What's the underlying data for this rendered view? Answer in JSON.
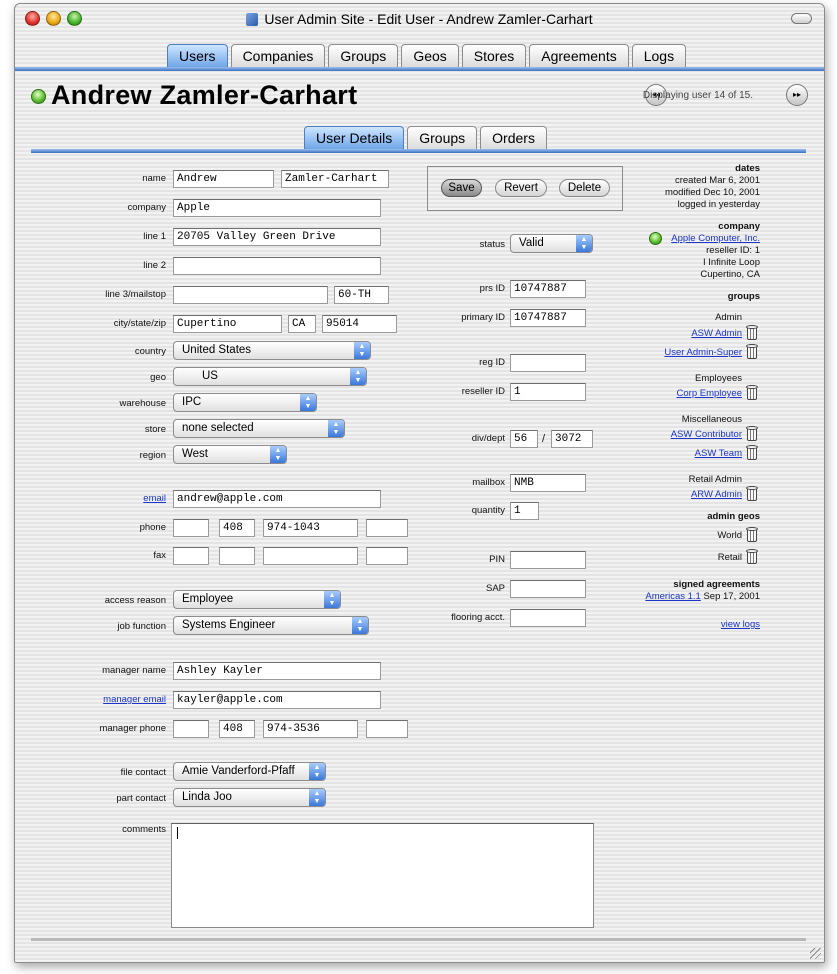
{
  "window": {
    "title": "User Admin Site - Edit User - Andrew Zamler-Carhart"
  },
  "main_tabs": [
    "Users",
    "Companies",
    "Groups",
    "Geos",
    "Stores",
    "Agreements",
    "Logs"
  ],
  "main_tab_active": "Users",
  "header": {
    "user_name": "Andrew Zamler-Carhart",
    "nav_text": "Displaying user 14 of 15."
  },
  "sub_tabs": [
    "User Details",
    "Groups",
    "Orders"
  ],
  "sub_tab_active": "User Details",
  "labels": {
    "name": "name",
    "company": "company",
    "line1": "line 1",
    "line2": "line 2",
    "line3": "line 3/mailstop",
    "city": "city/state/zip",
    "country": "country",
    "geo": "geo",
    "warehouse": "warehouse",
    "store": "store",
    "region": "region",
    "email": "email",
    "phone": "phone",
    "fax": "fax",
    "access_reason": "access reason",
    "job_function": "job function",
    "manager_name": "manager name",
    "manager_email": "manager email",
    "manager_phone": "manager phone",
    "file_contact": "file contact",
    "part_contact": "part contact",
    "comments": "comments",
    "status": "status",
    "prs_id": "prs ID",
    "primary_id": "primary ID",
    "reg_id": "reg ID",
    "reseller_id": "reseller ID",
    "div_dept": "div/dept",
    "mailbox": "mailbox",
    "quantity": "quantity",
    "pin": "PIN",
    "sap": "SAP",
    "flooring": "flooring acct."
  },
  "fields": {
    "first_name": "Andrew",
    "last_name": "Zamler-Carhart",
    "company": "Apple",
    "line1": "20705 Valley Green Drive",
    "line2": "",
    "line3": "",
    "mailstop": "60-TH",
    "city": "Cupertino",
    "state": "CA",
    "zip": "95014",
    "country": "United States",
    "geo": "US",
    "warehouse": "IPC",
    "store": "none selected",
    "region": "West",
    "email": "andrew@apple.com",
    "phone": [
      "",
      "408",
      "974-1043",
      ""
    ],
    "fax": [
      "",
      "",
      "",
      ""
    ],
    "access_reason": "Employee",
    "job_function": "Systems Engineer",
    "manager_name": "Ashley Kayler",
    "manager_email": "kayler@apple.com",
    "manager_phone": [
      "",
      "408",
      "974-3536",
      ""
    ],
    "file_contact": "Amie Vanderford-Pfaff",
    "part_contact": "Linda Joo",
    "comments": "",
    "status": "Valid",
    "prs_id": "10747887",
    "primary_id": "10747887",
    "reg_id": "",
    "reseller_id": "1",
    "div": "56",
    "div_sep": "/",
    "dept": "3072",
    "mailbox": "NMB",
    "quantity": "1",
    "pin": "",
    "sap": "",
    "flooring": ""
  },
  "actions": {
    "save": "Save",
    "revert": "Revert",
    "delete": "Delete"
  },
  "sidebar": {
    "dates_title": "dates",
    "created": "created Mar 6, 2001",
    "modified": "modified Dec 10, 2001",
    "logged": "logged in yesterday",
    "company_title": "company",
    "company_name": "Apple Computer, Inc.",
    "reseller": "reseller ID: 1",
    "address1": "I Infinite Loop",
    "address2": "Cupertino, CA",
    "groups_title": "groups",
    "group_sections": [
      {
        "title": "Admin",
        "items": [
          "ASW Admin",
          "User Admin-Super"
        ]
      },
      {
        "title": "Employees",
        "items": [
          "Corp Employee"
        ]
      },
      {
        "title": "Miscellaneous",
        "items": [
          "ASW Contributor",
          "ASW Team"
        ]
      },
      {
        "title": "Retail Admin",
        "items": [
          "ARW Admin"
        ]
      }
    ],
    "admin_geos_title": "admin geos",
    "admin_geos": [
      "World",
      "Retail"
    ],
    "agreements_title": "signed agreements",
    "agreement_link": "Americas 1.1",
    "agreement_date": "Sep 17, 2001",
    "view_logs": "view logs"
  },
  "colors": {
    "accent": "#3d70c0",
    "link": "#1a35c8",
    "status_led": "#5fc032"
  },
  "icons": {
    "trash": "trash-can-icon",
    "prev": "prev-user-icon",
    "next": "next-user-icon"
  }
}
